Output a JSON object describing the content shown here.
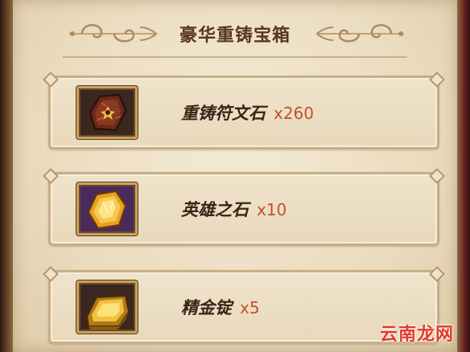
{
  "dialog": {
    "title": "豪华重铸宝箱"
  },
  "items": [
    {
      "name": "重铸符文石",
      "quantity": "x260",
      "icon": "rune-stone-icon"
    },
    {
      "name": "英雄之石",
      "quantity": "x10",
      "icon": "hero-stone-icon"
    },
    {
      "name": "精金锭",
      "quantity": "x5",
      "icon": "gold-ingot-icon"
    }
  ],
  "watermark": {
    "text": "云南龙网"
  },
  "colors": {
    "parchment": "#eadcbf",
    "title": "#5a3520",
    "quantity": "#c0522a",
    "watermark": "#e23a2a",
    "gold_border": "#c8a25a"
  }
}
